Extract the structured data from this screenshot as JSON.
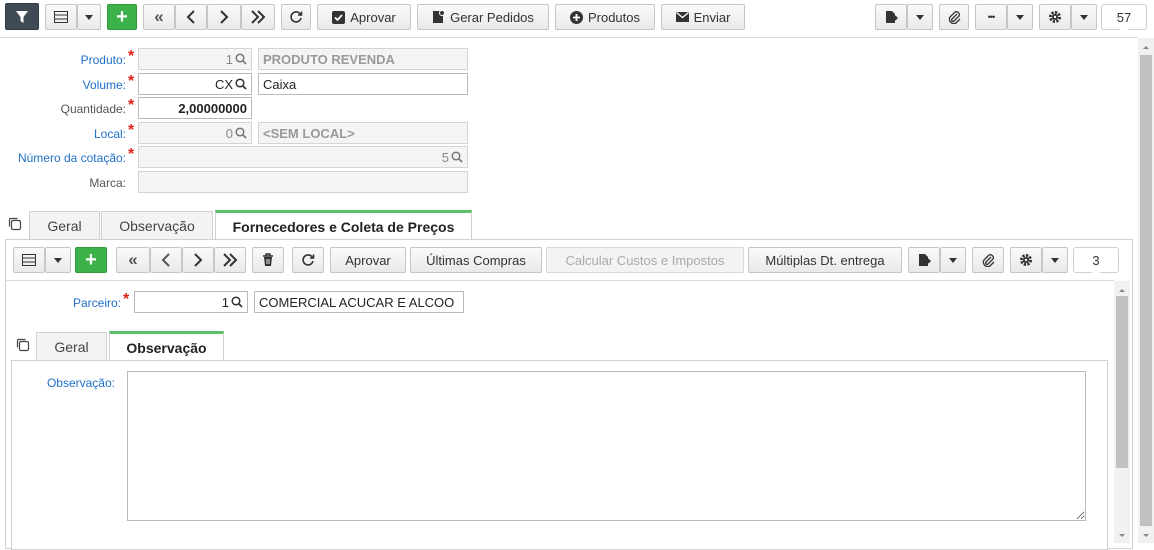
{
  "toolbar": {
    "approve_label": "Aprovar",
    "generate_orders_label": "Gerar Pedidos",
    "products_label": "Produtos",
    "send_label": "Enviar",
    "more_label": "•••",
    "record_count": "57"
  },
  "form": {
    "produto": {
      "label": "Produto:",
      "code": "1",
      "description": "PRODUTO REVENDA"
    },
    "volume": {
      "label": "Volume:",
      "code": "CX",
      "description": "Caixa"
    },
    "quantidade": {
      "label": "Quantidade:",
      "value": "2,00000000"
    },
    "local": {
      "label": "Local:",
      "code": "0",
      "description": "<SEM LOCAL>"
    },
    "numero_cotacao": {
      "label": "Número da cotação:",
      "value": "5"
    },
    "marca": {
      "label": "Marca:",
      "value": ""
    }
  },
  "tabs": [
    {
      "label": "Geral"
    },
    {
      "label": "Observação"
    },
    {
      "label": "Fornecedores e Coleta de Preços"
    }
  ],
  "subtoolbar": {
    "approve_label": "Aprovar",
    "last_purchases_label": "Últimas Compras",
    "calc_costs_label": "Calcular Custos e Impostos",
    "multiple_dates_label": "Múltiplas Dt. entrega",
    "record_count": "3"
  },
  "detail": {
    "parceiro": {
      "label": "Parceiro:",
      "code": "1",
      "description": "COMERCIAL ACUCAR E ALCOO"
    }
  },
  "inner_tabs": [
    {
      "label": "Geral"
    },
    {
      "label": "Observação"
    }
  ],
  "observacao": {
    "label": "Observação:",
    "value": ""
  },
  "colors": {
    "accent_green": "#3cb14a",
    "tab_active": "#5cc06a",
    "link_blue": "#1e6fc8",
    "required_red": "#e0231b"
  }
}
